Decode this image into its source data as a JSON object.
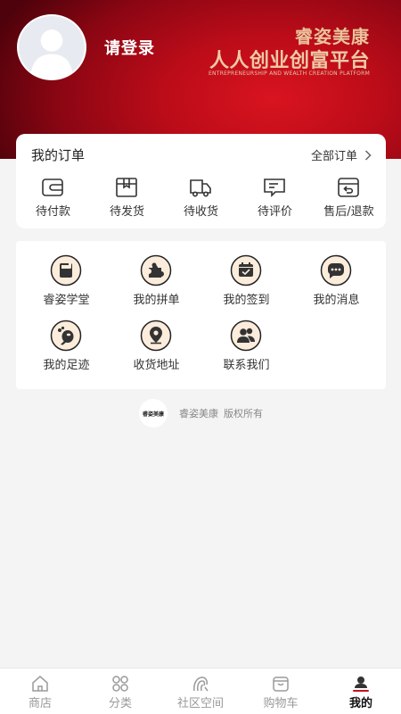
{
  "header": {
    "login_text": "请登录",
    "brand": "睿姿美康",
    "slogan": "人人创业创富平台",
    "slogan_en": "ENTREPRENEURSHIP AND WEALTH CREATION PLATFORM",
    "avatar_icon": "default-avatar-icon"
  },
  "orders": {
    "title": "我的订单",
    "all_label": "全部订单",
    "all_icon": "chevron-right-icon",
    "items": [
      {
        "label": "待付款",
        "icon": "wallet-icon"
      },
      {
        "label": "待发货",
        "icon": "package-icon"
      },
      {
        "label": "待收货",
        "icon": "truck-icon"
      },
      {
        "label": "待评价",
        "icon": "comment-icon"
      },
      {
        "label": "售后/退款",
        "icon": "return-icon"
      }
    ]
  },
  "services": {
    "items": [
      {
        "label": "睿姿学堂",
        "icon": "book-icon"
      },
      {
        "label": "我的拼单",
        "icon": "puzzle-icon"
      },
      {
        "label": "我的签到",
        "icon": "calendar-check-icon"
      },
      {
        "label": "我的消息",
        "icon": "message-icon"
      },
      {
        "label": "我的足迹",
        "icon": "footprint-icon"
      },
      {
        "label": "收货地址",
        "icon": "location-icon"
      },
      {
        "label": "联系我们",
        "icon": "contacts-icon"
      }
    ]
  },
  "footer": {
    "logo_text": "睿姿美康",
    "brand": "睿姿美康",
    "rights": "版权所有"
  },
  "tabbar": {
    "active": "我的",
    "items": [
      {
        "label": "商店",
        "icon": "home-icon"
      },
      {
        "label": "分类",
        "icon": "category-icon"
      },
      {
        "label": "社区空间",
        "icon": "community-icon"
      },
      {
        "label": "购物车",
        "icon": "cart-icon"
      },
      {
        "label": "我的",
        "icon": "profile-icon"
      }
    ]
  },
  "colors": {
    "header_red": "#c8101c",
    "header_dark": "#4e020b",
    "brand_gold": "#e9c39c",
    "icon_fill": "#fbecdc",
    "text_primary": "#333333",
    "tab_inactive": "#999999",
    "tab_active": "#111111",
    "background": "#f4f4f4"
  }
}
